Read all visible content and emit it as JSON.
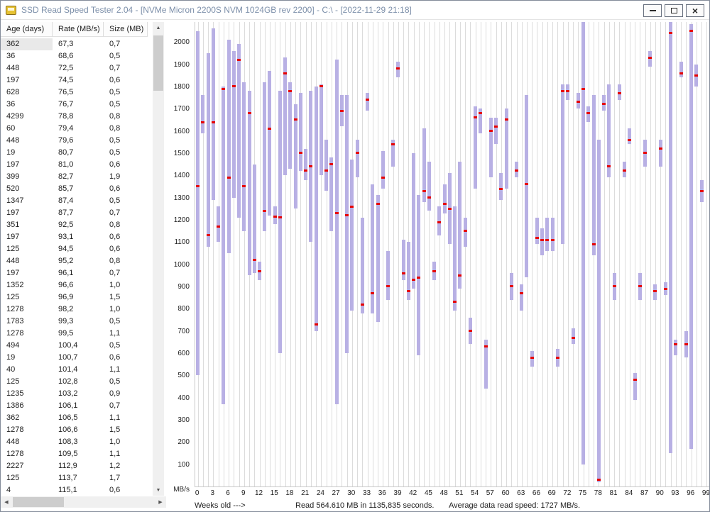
{
  "window": {
    "title": "SSD Read Speed Tester 2.04 - [NVMe Micron 2200S NVM 1024GB rev 2200] - C:\\ - [2022-11-29 21:18]",
    "controls": {
      "close_glyph": "×"
    }
  },
  "icons": {
    "up": "▲",
    "down": "▼",
    "left": "◀",
    "right": "▶"
  },
  "table": {
    "columns": [
      "Age (days)",
      "Rate (MB/s)",
      "Size (MB)"
    ],
    "selected": {
      "row": 0,
      "col": 0
    },
    "rows": [
      [
        "362",
        "67,3",
        "0,7"
      ],
      [
        "36",
        "68,6",
        "0,5"
      ],
      [
        "448",
        "72,5",
        "0,7"
      ],
      [
        "197",
        "74,5",
        "0,6"
      ],
      [
        "628",
        "76,5",
        "0,5"
      ],
      [
        "36",
        "76,7",
        "0,5"
      ],
      [
        "4299",
        "78,8",
        "0,8"
      ],
      [
        "60",
        "79,4",
        "0,8"
      ],
      [
        "448",
        "79,6",
        "0,5"
      ],
      [
        "19",
        "80,7",
        "0,5"
      ],
      [
        "197",
        "81,0",
        "0,6"
      ],
      [
        "399",
        "82,7",
        "1,9"
      ],
      [
        "520",
        "85,7",
        "0,6"
      ],
      [
        "1347",
        "87,4",
        "0,5"
      ],
      [
        "197",
        "87,7",
        "0,7"
      ],
      [
        "351",
        "92,5",
        "0,8"
      ],
      [
        "197",
        "93,1",
        "0,6"
      ],
      [
        "125",
        "94,5",
        "0,6"
      ],
      [
        "448",
        "95,2",
        "0,8"
      ],
      [
        "197",
        "96,1",
        "0,7"
      ],
      [
        "1352",
        "96,6",
        "1,0"
      ],
      [
        "125",
        "96,9",
        "1,5"
      ],
      [
        "1278",
        "98,2",
        "1,0"
      ],
      [
        "1783",
        "99,3",
        "0,5"
      ],
      [
        "1278",
        "99,5",
        "1,1"
      ],
      [
        "494",
        "100,4",
        "0,5"
      ],
      [
        "19",
        "100,7",
        "0,6"
      ],
      [
        "40",
        "101,4",
        "1,1"
      ],
      [
        "125",
        "102,8",
        "0,5"
      ],
      [
        "1235",
        "103,2",
        "0,9"
      ],
      [
        "1386",
        "106,1",
        "0,7"
      ],
      [
        "362",
        "106,5",
        "1,1"
      ],
      [
        "1278",
        "106,6",
        "1,5"
      ],
      [
        "448",
        "108,3",
        "1,0"
      ],
      [
        "1278",
        "109,5",
        "1,1"
      ],
      [
        "2227",
        "112,9",
        "1,2"
      ],
      [
        "125",
        "113,7",
        "1,7"
      ],
      [
        "4",
        "115,1",
        "0,6"
      ]
    ]
  },
  "status": {
    "x_axis_label": "Weeks old --->",
    "read_summary": "Read 564.610 MB in 1135,835 seconds.",
    "avg_speed": "Average data read speed: 1727 MB/s."
  },
  "chart_data": {
    "type": "bar",
    "subtype": "range-bars-with-average-marker",
    "xlabel": "Weeks old --->",
    "ylabel": "MB/s",
    "xlim": [
      0,
      99
    ],
    "ylim": [
      0,
      2090
    ],
    "grid": "vertical",
    "legend": "none",
    "bar_color": "#b8b0e4",
    "marker_color": "#e60000",
    "grid_color": "#dcdcdc",
    "x_ticks": [
      0,
      3,
      6,
      9,
      12,
      15,
      18,
      21,
      24,
      27,
      30,
      33,
      36,
      39,
      42,
      45,
      48,
      51,
      54,
      57,
      60,
      63,
      66,
      69,
      72,
      75,
      78,
      81,
      84,
      87,
      90,
      93,
      96,
      99
    ],
    "y_ticks": [
      2000,
      1900,
      1800,
      1700,
      1600,
      1500,
      1400,
      1300,
      1200,
      1100,
      1000,
      900,
      800,
      700,
      600,
      500,
      400,
      300,
      200,
      100
    ],
    "bars": [
      {
        "week": 0,
        "low": 500,
        "high": 2050,
        "marker": 1350
      },
      {
        "week": 1,
        "low": 1590,
        "high": 1760,
        "marker": 1640
      },
      {
        "week": 2,
        "low": 1080,
        "high": 1950,
        "marker": 1130
      },
      {
        "week": 3,
        "low": 1290,
        "high": 2060,
        "marker": 1640
      },
      {
        "week": 4,
        "low": 1100,
        "high": 1260,
        "marker": 1170
      },
      {
        "week": 5,
        "low": 370,
        "high": 1800,
        "marker": 1790
      },
      {
        "week": 6,
        "low": 1050,
        "high": 2010,
        "marker": 1390
      },
      {
        "week": 7,
        "low": 1300,
        "high": 1960,
        "marker": 1800
      },
      {
        "week": 8,
        "low": 1210,
        "high": 1990,
        "marker": 1920
      },
      {
        "week": 9,
        "low": 1150,
        "high": 1820,
        "marker": 1350
      },
      {
        "week": 10,
        "low": 950,
        "high": 1780,
        "marker": 1680
      },
      {
        "week": 11,
        "low": 960,
        "high": 1450,
        "marker": 1020
      },
      {
        "week": 12,
        "low": 930,
        "high": 1010,
        "marker": 970
      },
      {
        "week": 13,
        "low": 1150,
        "high": 1820,
        "marker": 1240
      },
      {
        "week": 14,
        "low": 1220,
        "high": 1870,
        "marker": 1610
      },
      {
        "week": 15,
        "low": 1180,
        "high": 1260,
        "marker": 1215
      },
      {
        "week": 16,
        "low": 600,
        "high": 1780,
        "marker": 1210
      },
      {
        "week": 17,
        "low": 1400,
        "high": 1930,
        "marker": 1860
      },
      {
        "week": 18,
        "low": 1430,
        "high": 1820,
        "marker": 1780
      },
      {
        "week": 19,
        "low": 1250,
        "high": 1720,
        "marker": 1650
      },
      {
        "week": 20,
        "low": 1420,
        "high": 1770,
        "marker": 1500
      },
      {
        "week": 21,
        "low": 1380,
        "high": 1520,
        "marker": 1420
      },
      {
        "week": 22,
        "low": 1100,
        "high": 1780,
        "marker": 1440
      },
      {
        "week": 23,
        "low": 700,
        "high": 1800,
        "marker": 730
      },
      {
        "week": 24,
        "low": 1400,
        "high": 1810,
        "marker": 1800
      },
      {
        "week": 25,
        "low": 1330,
        "high": 1560,
        "marker": 1420
      },
      {
        "week": 26,
        "low": 1150,
        "high": 1480,
        "marker": 1450
      },
      {
        "week": 27,
        "low": 370,
        "high": 1920,
        "marker": 1230
      },
      {
        "week": 28,
        "low": 1620,
        "high": 1760,
        "marker": 1690
      },
      {
        "week": 29,
        "low": 600,
        "high": 1760,
        "marker": 1220
      },
      {
        "week": 30,
        "low": 790,
        "high": 1470,
        "marker": 1260
      },
      {
        "week": 31,
        "low": 1390,
        "high": 1560,
        "marker": 1500
      },
      {
        "week": 32,
        "low": 780,
        "high": 1210,
        "marker": 820
      },
      {
        "week": 33,
        "low": 1690,
        "high": 1770,
        "marker": 1740
      },
      {
        "week": 34,
        "low": 780,
        "high": 1360,
        "marker": 870
      },
      {
        "week": 35,
        "low": 740,
        "high": 1310,
        "marker": 1270
      },
      {
        "week": 36,
        "low": 1340,
        "high": 1510,
        "marker": 1390
      },
      {
        "week": 37,
        "low": 840,
        "high": 1060,
        "marker": 900
      },
      {
        "week": 38,
        "low": 1440,
        "high": 1560,
        "marker": 1540
      },
      {
        "week": 39,
        "low": 1840,
        "high": 1910,
        "marker": 1880
      },
      {
        "week": 40,
        "low": 930,
        "high": 1110,
        "marker": 960
      },
      {
        "week": 41,
        "low": 840,
        "high": 1100,
        "marker": 880
      },
      {
        "week": 42,
        "low": 890,
        "high": 1500,
        "marker": 930
      },
      {
        "week": 43,
        "low": 590,
        "high": 1310,
        "marker": 940
      },
      {
        "week": 44,
        "low": 1280,
        "high": 1610,
        "marker": 1330
      },
      {
        "week": 45,
        "low": 1240,
        "high": 1460,
        "marker": 1300
      },
      {
        "week": 46,
        "low": 930,
        "high": 1010,
        "marker": 970
      },
      {
        "week": 47,
        "low": 1130,
        "high": 1260,
        "marker": 1190
      },
      {
        "week": 48,
        "low": 1230,
        "high": 1360,
        "marker": 1270
      },
      {
        "week": 49,
        "low": 1090,
        "high": 1410,
        "marker": 1250
      },
      {
        "week": 50,
        "low": 790,
        "high": 1260,
        "marker": 830
      },
      {
        "week": 51,
        "low": 890,
        "high": 1460,
        "marker": 950
      },
      {
        "week": 52,
        "low": 1080,
        "high": 1210,
        "marker": 1150
      },
      {
        "week": 53,
        "low": 640,
        "high": 760,
        "marker": 700
      },
      {
        "week": 54,
        "low": 1340,
        "high": 1710,
        "marker": 1660
      },
      {
        "week": 55,
        "low": 1590,
        "high": 1700,
        "marker": 1680
      },
      {
        "week": 56,
        "low": 440,
        "high": 660,
        "marker": 630
      },
      {
        "week": 57,
        "low": 1390,
        "high": 1660,
        "marker": 1600
      },
      {
        "week": 58,
        "low": 1540,
        "high": 1660,
        "marker": 1620
      },
      {
        "week": 59,
        "low": 1290,
        "high": 1410,
        "marker": 1340
      },
      {
        "week": 60,
        "low": 1340,
        "high": 1700,
        "marker": 1650
      },
      {
        "week": 61,
        "low": 840,
        "high": 960,
        "marker": 900
      },
      {
        "week": 62,
        "low": 1390,
        "high": 1460,
        "marker": 1420
      },
      {
        "week": 63,
        "low": 790,
        "high": 910,
        "marker": 870
      },
      {
        "week": 64,
        "low": 940,
        "high": 1760,
        "marker": 1360
      },
      {
        "week": 65,
        "low": 540,
        "high": 610,
        "marker": 580
      },
      {
        "week": 66,
        "low": 1090,
        "high": 1210,
        "marker": 1120
      },
      {
        "week": 67,
        "low": 1040,
        "high": 1160,
        "marker": 1110
      },
      {
        "week": 68,
        "low": 1060,
        "high": 1210,
        "marker": 1110
      },
      {
        "week": 69,
        "low": 1060,
        "high": 1210,
        "marker": 1110
      },
      {
        "week": 70,
        "low": 540,
        "high": 620,
        "marker": 580
      },
      {
        "week": 71,
        "low": 1090,
        "high": 1810,
        "marker": 1780
      },
      {
        "week": 72,
        "low": 1740,
        "high": 1810,
        "marker": 1780
      },
      {
        "week": 73,
        "low": 640,
        "high": 710,
        "marker": 670
      },
      {
        "week": 74,
        "low": 1700,
        "high": 1770,
        "marker": 1730
      },
      {
        "week": 75,
        "low": 100,
        "high": 2090,
        "marker": 1790
      },
      {
        "week": 76,
        "low": 1640,
        "high": 1710,
        "marker": 1680
      },
      {
        "week": 77,
        "low": 1040,
        "high": 1760,
        "marker": 1090
      },
      {
        "week": 78,
        "low": 20,
        "high": 1560,
        "marker": 30
      },
      {
        "week": 79,
        "low": 1690,
        "high": 1760,
        "marker": 1720
      },
      {
        "week": 80,
        "low": 1390,
        "high": 1810,
        "marker": 1440
      },
      {
        "week": 81,
        "low": 840,
        "high": 960,
        "marker": 900
      },
      {
        "week": 82,
        "low": 1740,
        "high": 1810,
        "marker": 1770
      },
      {
        "week": 83,
        "low": 1390,
        "high": 1460,
        "marker": 1420
      },
      {
        "week": 84,
        "low": 1540,
        "high": 1610,
        "marker": 1560
      },
      {
        "week": 85,
        "low": 390,
        "high": 510,
        "marker": 480
      },
      {
        "week": 86,
        "low": 840,
        "high": 960,
        "marker": 900
      },
      {
        "week": 87,
        "low": 1440,
        "high": 1560,
        "marker": 1500
      },
      {
        "week": 88,
        "low": 1890,
        "high": 1960,
        "marker": 1930
      },
      {
        "week": 89,
        "low": 840,
        "high": 910,
        "marker": 880
      },
      {
        "week": 90,
        "low": 1440,
        "high": 1560,
        "marker": 1520
      },
      {
        "week": 91,
        "low": 860,
        "high": 920,
        "marker": 890
      },
      {
        "week": 92,
        "low": 150,
        "high": 2090,
        "marker": 2040
      },
      {
        "week": 93,
        "low": 590,
        "high": 660,
        "marker": 640
      },
      {
        "week": 94,
        "low": 1840,
        "high": 1910,
        "marker": 1860
      },
      {
        "week": 95,
        "low": 580,
        "high": 700,
        "marker": 640
      },
      {
        "week": 96,
        "low": 170,
        "high": 2080,
        "marker": 2050
      },
      {
        "week": 97,
        "low": 1800,
        "high": 1900,
        "marker": 1850
      },
      {
        "week": 98,
        "low": 1280,
        "high": 1380,
        "marker": 1330
      }
    ]
  }
}
